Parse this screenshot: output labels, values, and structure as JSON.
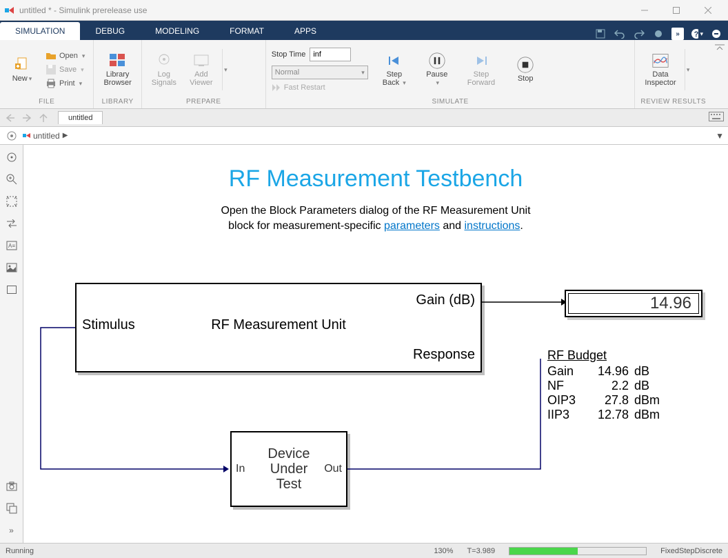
{
  "window": {
    "title": "untitled * - Simulink prerelease use"
  },
  "tabs": {
    "items": [
      "SIMULATION",
      "DEBUG",
      "MODELING",
      "FORMAT",
      "APPS"
    ],
    "active_index": 0
  },
  "toolstrip": {
    "file": {
      "new": "New",
      "open": "Open",
      "save": "Save",
      "print": "Print",
      "group": "FILE"
    },
    "library": {
      "browser": "Library\nBrowser",
      "group": "LIBRARY"
    },
    "prepare": {
      "log": "Log\nSignals",
      "viewer": "Add\nViewer",
      "group": "PREPARE"
    },
    "stoptime_label": "Stop Time",
    "stoptime_value": "inf",
    "mode": "Normal",
    "fast_restart": "Fast Restart",
    "simulate": {
      "step_back": "Step\nBack",
      "pause": "Pause",
      "step_forward": "Step\nForward",
      "stop": "Stop",
      "group": "SIMULATE"
    },
    "review": {
      "data_inspector": "Data\nInspector",
      "group": "REVIEW RESULTS"
    }
  },
  "doc_tab": "untitled",
  "breadcrumb": "untitled",
  "canvas": {
    "title": "RF Measurement Testbench",
    "desc_1": "Open the Block Parameters dialog of the RF Measurement Unit",
    "desc_2a": "block for measurement-specific ",
    "link1": "parameters",
    "desc_2b": " and ",
    "link2": "instructions",
    "desc_2c": ".",
    "rf_block": {
      "stimulus": "Stimulus",
      "name": "RF Measurement Unit",
      "gain": "Gain (dB)",
      "response": "Response"
    },
    "dut": {
      "in": "In",
      "name": "Device\nUnder\nTest",
      "out": "Out"
    },
    "display_value": "14.96",
    "budget": {
      "title": "RF Budget",
      "rows": [
        {
          "k": "Gain",
          "v": "14.96",
          "u": "dB"
        },
        {
          "k": "NF",
          "v": "2.2",
          "u": "dB"
        },
        {
          "k": "OIP3",
          "v": "27.8",
          "u": "dBm"
        },
        {
          "k": "IIP3",
          "v": "12.78",
          "u": "dBm"
        }
      ]
    }
  },
  "status": {
    "state": "Running",
    "zoom": "130%",
    "time": "T=3.989",
    "solver": "FixedStepDiscrete"
  }
}
